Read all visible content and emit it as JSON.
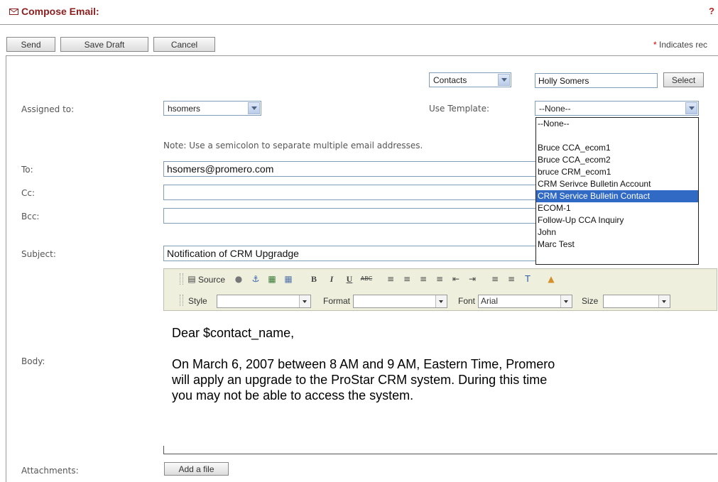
{
  "header": {
    "title": "Compose Email:",
    "help": "?"
  },
  "toolbar": {
    "send": "Send",
    "save_draft": "Save Draft",
    "cancel": "Cancel"
  },
  "required_note": {
    "star": "*",
    "text": " Indicates rec"
  },
  "contacts_select": {
    "value": "Contacts"
  },
  "contact_name": {
    "value": "Holly Somers"
  },
  "select_button": "Select",
  "assigned_to": {
    "label": "Assigned to:",
    "value": "hsomers"
  },
  "template": {
    "label": "Use Template:",
    "value": "--None--",
    "options": [
      "--None--",
      "",
      "Bruce CCA_ecom1",
      "Bruce CCA_ecom2",
      "bruce CRM_ecom1",
      "CRM Serivce Bulletin Account",
      "CRM Service Bulletin Contact",
      "ECOM-1",
      "Follow-Up CCA Inquiry",
      "John",
      "Marc Test"
    ],
    "highlighted_index": 6
  },
  "note": "Note: Use a semicolon to separate multiple email addresses.",
  "to": {
    "label": "To:",
    "value": "hsomers@promero.com"
  },
  "cc": {
    "label": "Cc:",
    "value": ""
  },
  "bcc": {
    "label": "Bcc:",
    "value": ""
  },
  "subject": {
    "label": "Subject:",
    "value": "Notification of CRM Upgradge"
  },
  "editor": {
    "source": "Source",
    "style_label": "Style",
    "format_label": "Format",
    "font_label": "Font",
    "font_value": "Arial",
    "size_label": "Size"
  },
  "body": {
    "label": "Body:",
    "greeting": "Dear $contact_name,",
    "line1": "On March 6, 2007 between 8 AM and 9 AM, Eastern Time, Promero",
    "line2": "will apply an upgrade to the ProStar CRM system.  During this time",
    "line3": "you may not be able to access the system."
  },
  "attachments": {
    "label": "Attachments:",
    "button": "Add a file"
  }
}
